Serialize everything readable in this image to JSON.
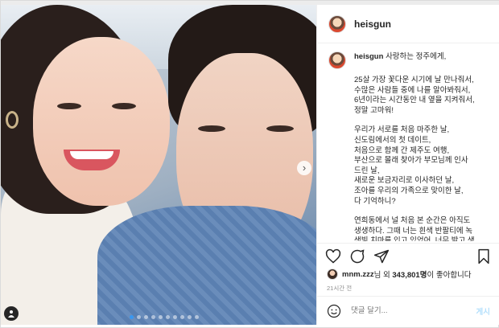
{
  "post": {
    "username": "heisgun",
    "caption_user": "heisgun",
    "caption_greeting": "사랑하는 정주에게,",
    "paragraphs": [
      "25살 가장 꽃다운 시기에 날 만나줘서,\n수많은 사람들 중에 나를 알아봐줘서,\n6년이라는 시간동안 내 옆을 지켜줘서,\n정말 고마워!",
      "우리가 서로를 처음 마주한 날,\n신도림에서의 첫 데이트,\n처음으로 함께 간 제주도 여행,\n부산으로 몰래 찾아가 부모님께 인사\n드린 날,\n새로운 보금자리로 이사하던 날,\n조아를 우리의 가족으로 맞이한 날,\n다 기억하니?",
      "연희동에서 널 처음 본 순간은 아직도\n생생하다. 그때 너는 흰색 반팔티에 녹\n색빛 치마를 입고 있었어. 너무 밝고 생"
    ],
    "likes_user": "mnm.zzz",
    "likes_mid": "님 외 ",
    "likes_count": "343,801명",
    "likes_tail": "이 좋아합니다",
    "time_ago": "21시간 전",
    "comment_placeholder": "댓글 달기...",
    "post_button": "게시",
    "next_symbol": "›",
    "carousel": {
      "slides": 10,
      "active": 0
    }
  },
  "icons": {
    "like": "heart-icon",
    "comment": "comment-icon",
    "share": "share-icon",
    "save": "bookmark-icon",
    "emoji": "emoji-icon",
    "tag": "user-tag-icon"
  },
  "colors": {
    "accent": "#3897f0",
    "post_disabled": "#b2dffc"
  }
}
